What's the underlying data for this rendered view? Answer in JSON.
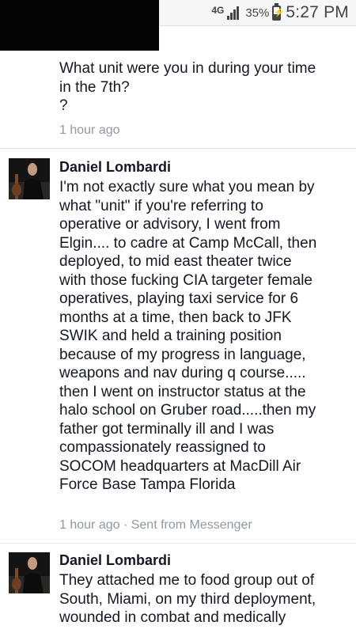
{
  "status_bar": {
    "network": "4G",
    "battery_percent": "35%",
    "battery_level": 0.35,
    "time": "5:27 PM"
  },
  "messages": [
    {
      "text_lines": [
        "What unit were you in during your time",
        "in the 7th?",
        "?"
      ],
      "meta": "1 hour ago"
    },
    {
      "sender": "Daniel Lombardi",
      "text_lines": [
        "I'm not exactly sure what you mean by",
        "what \"unit\" if you're referring to",
        "operative or advisory, I went from",
        "Elgin.... to cadre at Camp McCall, then",
        "deployed, to mid east theater twice",
        "with those fucking CIA targeter female",
        "operatives, playing taxi service for 6",
        "months at a time, then back to JFK",
        "SWIK and held a training position",
        "because of my progress in language,",
        "weapons and nav during q course.....",
        "then I went on instructor status at the",
        "halo school on Gruber road.....then my",
        "father got terminally ill and I was",
        "compassionately reassigned to",
        "SOCOM headquarters at MacDill Air",
        "Force Base Tampa Florida"
      ],
      "meta": "1 hour ago · Sent from Messenger"
    },
    {
      "sender": "Daniel Lombardi",
      "text_lines": [
        "They attached me to food group out of",
        "South, Miami, on my third deployment,",
        "wounded in combat and medically"
      ]
    }
  ]
}
